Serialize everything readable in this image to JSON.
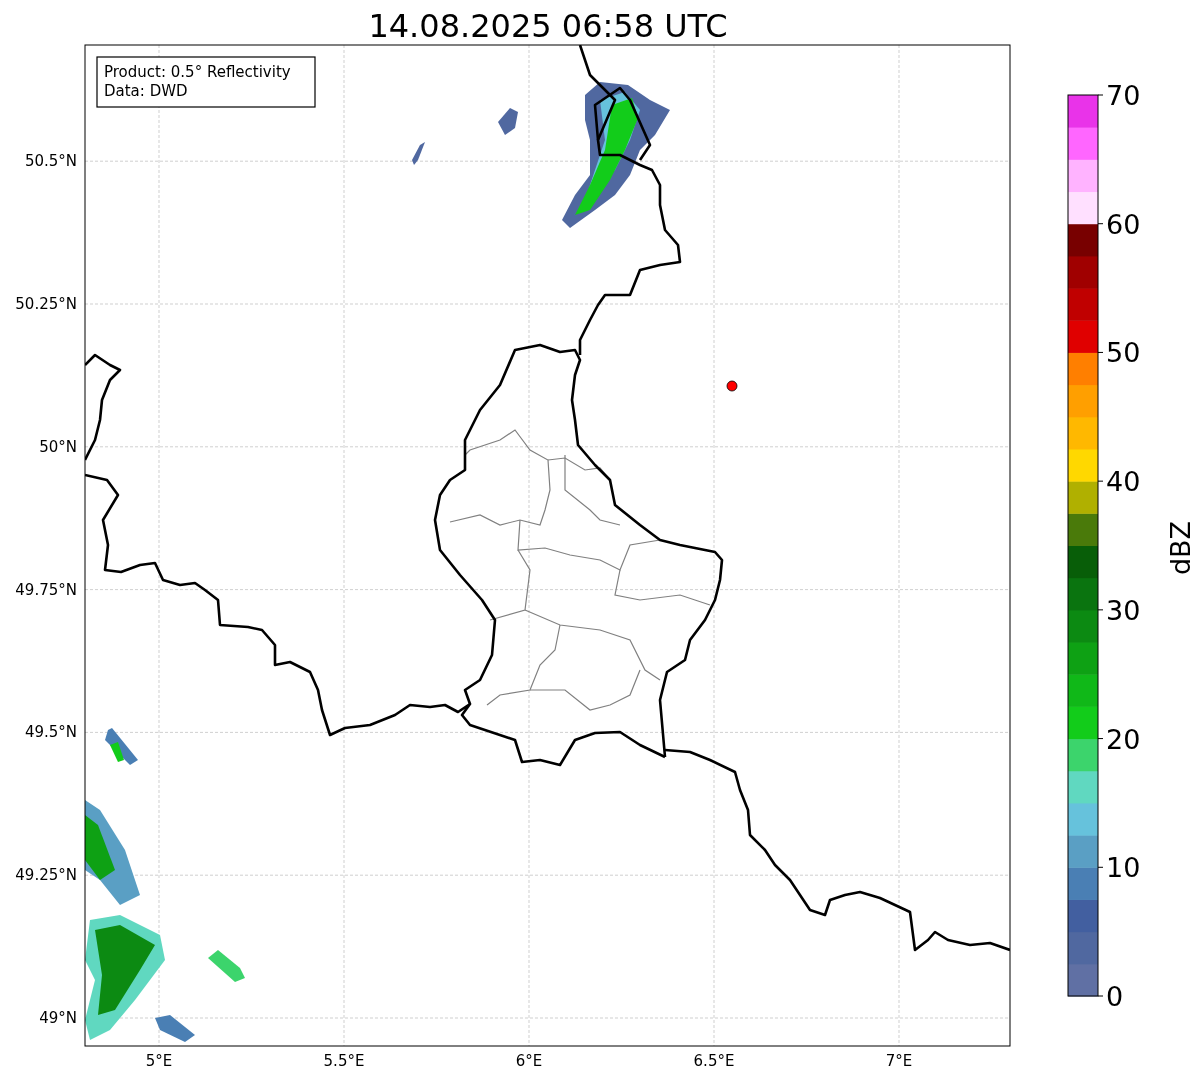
{
  "title": "14.08.2025 06:58 UTC",
  "legend": {
    "lines": [
      "Product: 0.5° Reflectivity",
      "Data: DWD"
    ]
  },
  "x_axis": {
    "ticks": [
      "5°E",
      "5.5°E",
      "6°E",
      "6.5°E",
      "7°E"
    ]
  },
  "y_axis": {
    "ticks": [
      "50.5°N",
      "50.25°N",
      "50°N",
      "49.75°N",
      "49.5°N",
      "49.25°N",
      "49°N"
    ]
  },
  "colorbar": {
    "label": "dBZ",
    "ticks": [
      "70",
      "60",
      "50",
      "40",
      "30",
      "20",
      "10",
      "0"
    ],
    "segments": [
      {
        "color": "#6070a4"
      },
      {
        "color": "#5068a0"
      },
      {
        "color": "#425fa0"
      },
      {
        "color": "#4a7fb4"
      },
      {
        "color": "#5a9fc4"
      },
      {
        "color": "#66c2dc"
      },
      {
        "color": "#60d8c0"
      },
      {
        "color": "#3cd46c"
      },
      {
        "color": "#12cc1a"
      },
      {
        "color": "#10b818"
      },
      {
        "color": "#0ea114"
      },
      {
        "color": "#0c8a12"
      },
      {
        "color": "#0a740f"
      },
      {
        "color": "#085e08"
      },
      {
        "color": "#4a7a0a"
      },
      {
        "color": "#b0b000"
      },
      {
        "color": "#ffd800"
      },
      {
        "color": "#ffb800"
      },
      {
        "color": "#ff9f00"
      },
      {
        "color": "#ff7f00"
      },
      {
        "color": "#e00000"
      },
      {
        "color": "#c00000"
      },
      {
        "color": "#a00000"
      },
      {
        "color": "#780000"
      },
      {
        "color": "#ffe0ff"
      },
      {
        "color": "#ffb3ff"
      },
      {
        "color": "#ff66ff"
      },
      {
        "color": "#e933e9"
      }
    ]
  }
}
